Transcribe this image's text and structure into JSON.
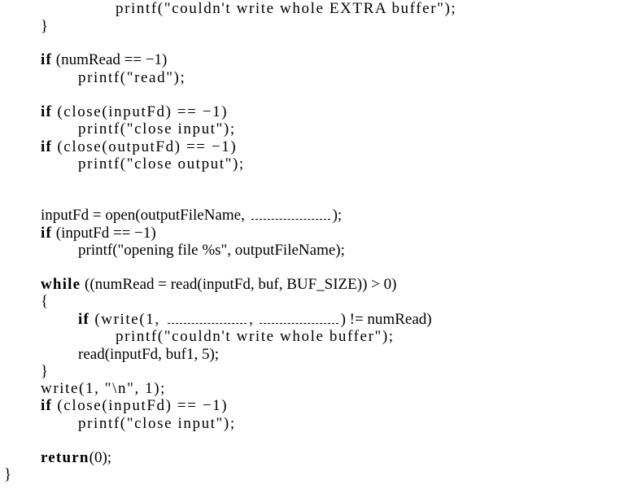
{
  "document": {
    "type": "code-listing",
    "language": "C",
    "lines": [
      {
        "indent": 2,
        "parts": [
          {
            "t": "printf(\"couldn't write whole EXTRA buffer\");",
            "style": "tt"
          }
        ]
      },
      {
        "indent": 1,
        "parts": [
          {
            "t": "}",
            "style": "plain"
          }
        ]
      },
      {
        "indent": 1,
        "parts": [
          {
            "t": "if",
            "style": "kw"
          },
          {
            "t": " (numRead == −1)",
            "style": "plain"
          }
        ]
      },
      {
        "indent": 1.5,
        "parts": [
          {
            "t": "printf(\"read\");",
            "style": "tt"
          }
        ]
      },
      {
        "indent": 1,
        "parts": [
          {
            "t": "if",
            "style": "kw"
          },
          {
            "t": " (close(inputFd) == −1)",
            "style": "tt"
          }
        ]
      },
      {
        "indent": 1.5,
        "parts": [
          {
            "t": "printf(\"close input\");",
            "style": "tt"
          }
        ]
      },
      {
        "indent": 1,
        "parts": [
          {
            "t": "if",
            "style": "kw"
          },
          {
            "t": " (close(outputFd) == −1)",
            "style": "tt"
          }
        ]
      },
      {
        "indent": 1.5,
        "parts": [
          {
            "t": "printf(\"close output\");",
            "style": "tt"
          }
        ]
      },
      {
        "indent": 1,
        "parts": [
          {
            "t": "inputFd = open(outputFileName, ",
            "style": "plain"
          },
          {
            "blank": true
          },
          {
            "t": ");",
            "style": "plain"
          }
        ]
      },
      {
        "indent": 1,
        "parts": [
          {
            "t": "if",
            "style": "kw"
          },
          {
            "t": " (inputFd == −1)",
            "style": "plain"
          }
        ]
      },
      {
        "indent": 1.5,
        "parts": [
          {
            "t": "printf(\"opening file %s\", outputFileName);",
            "style": "plain"
          }
        ]
      },
      {
        "indent": 1,
        "parts": [
          {
            "t": "while",
            "style": "kw"
          },
          {
            "t": " ((numRead = read(inputFd, buf, BUF_SIZE)) > 0)",
            "style": "plain"
          }
        ]
      },
      {
        "indent": 1,
        "parts": [
          {
            "t": "{",
            "style": "plain"
          }
        ]
      },
      {
        "indent": 1.5,
        "parts": [
          {
            "t": "if",
            "style": "kw"
          },
          {
            "t": " (write(1, ",
            "style": "tt"
          },
          {
            "blank": true
          },
          {
            "t": ", ",
            "style": "plain"
          },
          {
            "blank": true
          },
          {
            "t": ") != numRead)",
            "style": "plain"
          }
        ]
      },
      {
        "indent": 2,
        "parts": [
          {
            "t": "printf(\"couldn't write whole buffer\");",
            "style": "tt"
          }
        ]
      },
      {
        "indent": 1.5,
        "parts": [
          {
            "t": "read(inputFd, buf1, 5);",
            "style": "plain"
          }
        ]
      },
      {
        "indent": 1,
        "parts": [
          {
            "t": "}",
            "style": "plain"
          }
        ]
      },
      {
        "indent": 1,
        "parts": [
          {
            "t": "write(1, \"\\n\", 1);",
            "style": "tt"
          }
        ]
      },
      {
        "indent": 1,
        "parts": [
          {
            "t": "if",
            "style": "kw"
          },
          {
            "t": " (close(inputFd) == −1)",
            "style": "tt"
          }
        ]
      },
      {
        "indent": 1.5,
        "parts": [
          {
            "t": "printf(\"close input\");",
            "style": "tt"
          }
        ]
      },
      {
        "indent": 1,
        "parts": [
          {
            "t": "return",
            "style": "kw"
          },
          {
            "t": "(0);",
            "style": "plain"
          }
        ]
      },
      {
        "indent": 0,
        "parts": [
          {
            "t": "}",
            "style": "plain"
          }
        ]
      }
    ]
  }
}
